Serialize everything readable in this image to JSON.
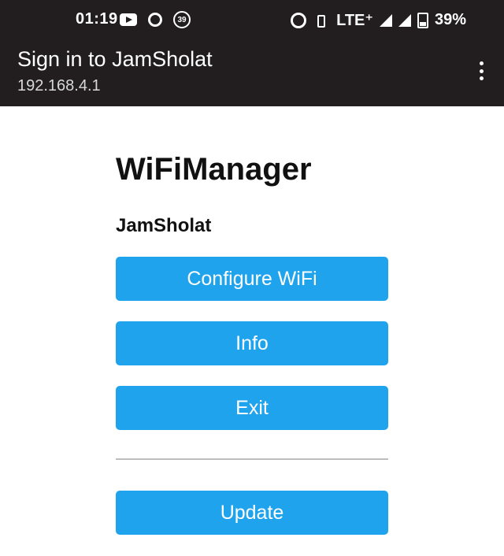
{
  "status_bar": {
    "time": "01:19",
    "notification_count": "39",
    "network": "LTE⁺",
    "battery": "39%"
  },
  "app_bar": {
    "title": "Sign in to JamSholat",
    "subtitle": "192.168.4.1"
  },
  "page": {
    "title": "WiFiManager",
    "ap_name": "JamSholat",
    "buttons": {
      "configure": "Configure WiFi",
      "info": "Info",
      "exit": "Exit",
      "update": "Update"
    }
  },
  "colors": {
    "topbar": "#221e1f",
    "button": "#1fa3ec"
  }
}
